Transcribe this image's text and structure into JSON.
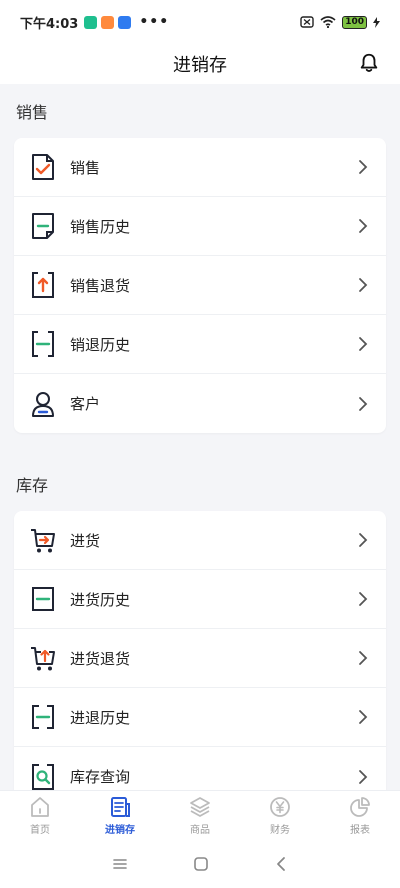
{
  "status_bar": {
    "time": "下午4:03",
    "dots": "•••",
    "battery": "100",
    "app_icon_colors": [
      "#1fbf8f",
      "#ff8a3d",
      "#2f7bf0"
    ]
  },
  "header": {
    "title": "进销存",
    "icon": "bell-icon"
  },
  "sections": [
    {
      "title": "销售",
      "items": [
        {
          "label": "销售",
          "icon": "sale-check-icon"
        },
        {
          "label": "销售历史",
          "icon": "sale-history-icon"
        },
        {
          "label": "销售退货",
          "icon": "sale-return-icon"
        },
        {
          "label": "销退历史",
          "icon": "return-history-icon"
        },
        {
          "label": "客户",
          "icon": "customer-icon"
        }
      ]
    },
    {
      "title": "库存",
      "items": [
        {
          "label": "进货",
          "icon": "purchase-cart-icon"
        },
        {
          "label": "进货历史",
          "icon": "purchase-history-icon"
        },
        {
          "label": "进货退货",
          "icon": "purchase-return-icon"
        },
        {
          "label": "进退历史",
          "icon": "purchase-return-history-icon"
        },
        {
          "label": "库存查询",
          "icon": "inventory-search-icon"
        }
      ]
    }
  ],
  "tabbar": {
    "tabs": [
      {
        "label": "首页",
        "icon": "home-icon",
        "active": false
      },
      {
        "label": "进销存",
        "icon": "document-icon",
        "active": true
      },
      {
        "label": "商品",
        "icon": "layers-icon",
        "active": false
      },
      {
        "label": "财务",
        "icon": "yen-icon",
        "active": false
      },
      {
        "label": "报表",
        "icon": "pie-chart-icon",
        "active": false
      }
    ]
  },
  "colors": {
    "accent": "#2b5bd7",
    "icon_dark": "#1f2433",
    "icon_orange": "#f05a28",
    "icon_green": "#2fb37a",
    "background": "#f4f5f8"
  }
}
